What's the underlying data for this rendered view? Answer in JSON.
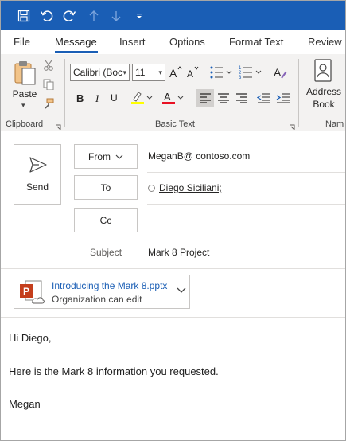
{
  "qat": {
    "icons": [
      "save-icon",
      "undo-icon",
      "redo-icon",
      "up-arrow-icon",
      "down-arrow-icon",
      "customize-qat-icon"
    ]
  },
  "tabs": [
    {
      "label": "File",
      "active": false
    },
    {
      "label": "Message",
      "active": true
    },
    {
      "label": "Insert",
      "active": false
    },
    {
      "label": "Options",
      "active": false
    },
    {
      "label": "Format Text",
      "active": false
    },
    {
      "label": "Review",
      "active": false
    }
  ],
  "ribbon": {
    "clipboard": {
      "paste_label": "Paste",
      "group_label": "Clipboard"
    },
    "basic_text": {
      "font_name": "Calibri (Boc",
      "font_size": "11",
      "group_label": "Basic Text"
    },
    "names": {
      "address_book_line1": "Address",
      "address_book_line2": "Book",
      "group_label": "Nam"
    }
  },
  "compose": {
    "send_label": "Send",
    "from_label": "From",
    "from_value": "MeganB@ contoso.com",
    "to_label": "To",
    "to_value": "Diego Siciliani;",
    "cc_label": "Cc",
    "subject_label": "Subject",
    "subject_value": "Mark 8 Project"
  },
  "attachment": {
    "filename": "Introducing the Mark 8.pptx",
    "permission": "Organization can edit"
  },
  "body": {
    "lines": [
      "Hi Diego,",
      "Here is the Mark 8 information you requested.",
      "Megan"
    ]
  },
  "colors": {
    "titlebar": "#1a5eb5",
    "accent": "#1a5eb5",
    "ribbon_bg": "#f3f2f1",
    "highlight": "#ffff00",
    "font_color": "#e81123",
    "pptx": "#c43e1c"
  }
}
